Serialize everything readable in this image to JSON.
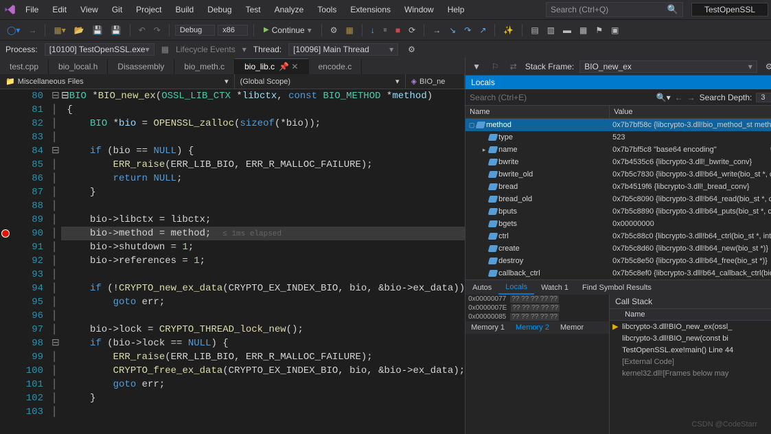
{
  "menu": [
    "File",
    "Edit",
    "View",
    "Git",
    "Project",
    "Build",
    "Debug",
    "Test",
    "Analyze",
    "Tools",
    "Extensions",
    "Window",
    "Help"
  ],
  "search_placeholder": "Search (Ctrl+Q)",
  "project_name": "TestOpenSSL",
  "config_combo": "Debug",
  "platform_combo": "x86",
  "continue_label": "Continue",
  "process_label": "Process:",
  "process_value": "[10100] TestOpenSSL.exe",
  "lifecycle_label": "Lifecycle Events",
  "thread_label": "Thread:",
  "thread_value": "[10096] Main Thread",
  "stackframe_label": "Stack Frame:",
  "stackframe_value": "BIO_new_ex",
  "tabs": [
    {
      "label": "test.cpp",
      "active": false
    },
    {
      "label": "bio_local.h",
      "active": false
    },
    {
      "label": "Disassembly",
      "active": false
    },
    {
      "label": "bio_meth.c",
      "active": false
    },
    {
      "label": "bio_lib.c",
      "active": true,
      "pinned": true
    },
    {
      "label": "encode.c",
      "active": false
    }
  ],
  "nav": {
    "scope": "Miscellaneous Files",
    "func": "(Global Scope)",
    "member": "BIO_ne"
  },
  "first_line": 80,
  "breakpoint_line": 90,
  "timing": "≤ 1ms elapsed",
  "locals_title": "Locals",
  "locals_search_placeholder": "Search (Ctrl+E)",
  "search_depth_label": "Search Depth:",
  "search_depth_value": "3",
  "locals_cols": {
    "name": "Name",
    "value": "Value"
  },
  "locals": [
    {
      "indent": 0,
      "exp": "▢",
      "name": "method",
      "value": "0x7b7bf58c {libcrypto-3.dll!bio_method_st meth.",
      "sel": true
    },
    {
      "indent": 1,
      "exp": "",
      "name": "type",
      "value": "523"
    },
    {
      "indent": 1,
      "exp": "▸",
      "name": "name",
      "value": "0x7b7bf5c8 \"base64 encoding\"",
      "mag": true
    },
    {
      "indent": 1,
      "exp": "",
      "name": "bwrite",
      "value": "0x7b4535c6 {libcrypto-3.dll!_bwrite_conv}"
    },
    {
      "indent": 1,
      "exp": "",
      "name": "bwrite_old",
      "value": "0x7b5c7830 {libcrypto-3.dll!b64_write(bio_st *, c..."
    },
    {
      "indent": 1,
      "exp": "",
      "name": "bread",
      "value": "0x7b4519f6 {libcrypto-3.dll!_bread_conv}"
    },
    {
      "indent": 1,
      "exp": "",
      "name": "bread_old",
      "value": "0x7b5c8090 {libcrypto-3.dll!b64_read(bio_st *, ch"
    },
    {
      "indent": 1,
      "exp": "",
      "name": "bputs",
      "value": "0x7b5c8890 {libcrypto-3.dll!b64_puts(bio_st *, co"
    },
    {
      "indent": 1,
      "exp": "",
      "name": "bgets",
      "value": "0x00000000"
    },
    {
      "indent": 1,
      "exp": "",
      "name": "ctrl",
      "value": "0x7b5c88c0 {libcrypto-3.dll!b64_ctrl(bio_st *, int,"
    },
    {
      "indent": 1,
      "exp": "",
      "name": "create",
      "value": "0x7b5c8d60 {libcrypto-3.dll!b64_new(bio_st *)}"
    },
    {
      "indent": 1,
      "exp": "",
      "name": "destroy",
      "value": "0x7b5c8e50 {libcrypto-3.dll!b64_free(bio_st *)}"
    },
    {
      "indent": 1,
      "exp": "",
      "name": "callback_ctrl",
      "value": "0x7b5c8ef0 {libcrypto-3.dll!b64_callback_ctrl(bio"
    }
  ],
  "debug_tabs": [
    "Autos",
    "Locals",
    "Watch 1",
    "Find Symbol Results"
  ],
  "debug_tab_active": "Locals",
  "memory_rows": [
    {
      "addr": "0x00000077",
      "hex": "?? ?? ?? ?? ??"
    },
    {
      "addr": "0x0000007E",
      "hex": "?? ?? ?? ?? ??"
    },
    {
      "addr": "0x00000085",
      "hex": "?? ?? ?? ?? ??"
    }
  ],
  "memory_tabs": [
    "Memory 1",
    "Memory 2",
    "Memor"
  ],
  "memory_tab_active": "Memory 2",
  "callstack_title": "Call Stack",
  "callstack_col": "Name",
  "callstack": [
    {
      "cur": true,
      "text": "libcrypto-3.dll!BIO_new_ex(ossl_"
    },
    {
      "cur": false,
      "text": "libcrypto-3.dll!BIO_new(const bi"
    },
    {
      "cur": false,
      "text": "TestOpenSSL.exe!main() Line 44"
    },
    {
      "cur": false,
      "text": "[External Code]",
      "dim": true
    },
    {
      "cur": false,
      "text": "kernel32.dll![Frames below may",
      "dim": true
    }
  ],
  "watermark": "CSDN @CodeStarr"
}
